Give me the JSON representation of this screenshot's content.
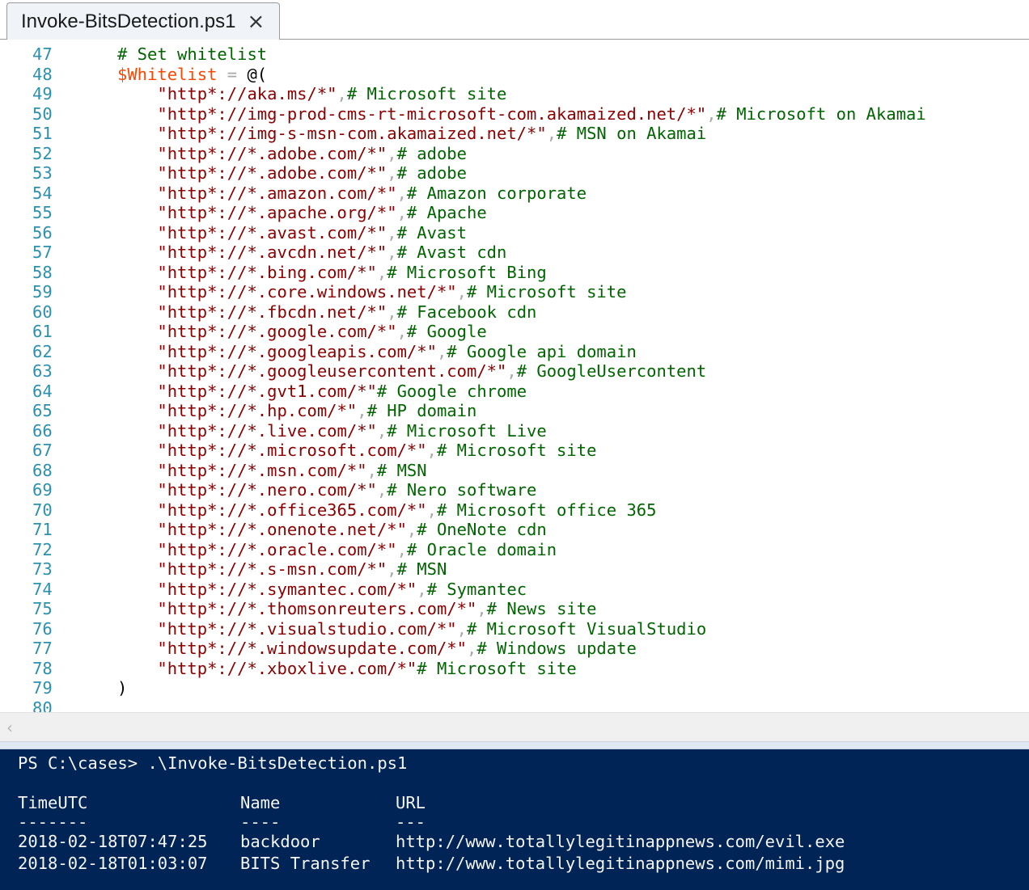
{
  "tab": {
    "title": "Invoke-BitsDetection.ps1",
    "close_icon": "×"
  },
  "editor": {
    "lines": [
      {
        "num": "47",
        "parts": [
          {
            "cls": "cmt",
            "text": "# Set whitelist"
          }
        ]
      },
      {
        "num": "48",
        "parts": [
          {
            "cls": "var",
            "text": "$Whitelist"
          },
          {
            "cls": "op",
            "text": " = "
          },
          {
            "cls": "",
            "text": "@("
          }
        ]
      },
      {
        "num": "49",
        "parts": [
          {
            "cls": "str",
            "text": "    \"http*://aka.ms/*\""
          },
          {
            "cls": "op",
            "text": ","
          },
          {
            "cls": "cmt",
            "text": "# Microsoft site"
          }
        ]
      },
      {
        "num": "50",
        "parts": [
          {
            "cls": "str",
            "text": "    \"http*://img-prod-cms-rt-microsoft-com.akamaized.net/*\""
          },
          {
            "cls": "op",
            "text": ","
          },
          {
            "cls": "cmt",
            "text": "# Microsoft on Akamai"
          }
        ]
      },
      {
        "num": "51",
        "parts": [
          {
            "cls": "str",
            "text": "    \"http*://img-s-msn-com.akamaized.net/*\""
          },
          {
            "cls": "op",
            "text": ","
          },
          {
            "cls": "cmt",
            "text": "# MSN on Akamai"
          }
        ]
      },
      {
        "num": "52",
        "parts": [
          {
            "cls": "str",
            "text": "    \"http*://*.adobe.com/*\""
          },
          {
            "cls": "op",
            "text": ","
          },
          {
            "cls": "cmt",
            "text": "# adobe"
          }
        ]
      },
      {
        "num": "53",
        "parts": [
          {
            "cls": "str",
            "text": "    \"http*://*.adobe.com/*\""
          },
          {
            "cls": "op",
            "text": ","
          },
          {
            "cls": "cmt",
            "text": "# adobe"
          }
        ]
      },
      {
        "num": "54",
        "parts": [
          {
            "cls": "str",
            "text": "    \"http*://*.amazon.com/*\""
          },
          {
            "cls": "op",
            "text": ","
          },
          {
            "cls": "cmt",
            "text": "# Amazon corporate"
          }
        ]
      },
      {
        "num": "55",
        "parts": [
          {
            "cls": "str",
            "text": "    \"http*://*.apache.org/*\""
          },
          {
            "cls": "op",
            "text": ","
          },
          {
            "cls": "cmt",
            "text": "# Apache"
          }
        ]
      },
      {
        "num": "56",
        "parts": [
          {
            "cls": "str",
            "text": "    \"http*://*.avast.com/*\""
          },
          {
            "cls": "op",
            "text": ","
          },
          {
            "cls": "cmt",
            "text": "# Avast"
          }
        ]
      },
      {
        "num": "57",
        "parts": [
          {
            "cls": "str",
            "text": "    \"http*://*.avcdn.net/*\""
          },
          {
            "cls": "op",
            "text": ","
          },
          {
            "cls": "cmt",
            "text": "# Avast cdn"
          }
        ]
      },
      {
        "num": "58",
        "parts": [
          {
            "cls": "str",
            "text": "    \"http*://*.bing.com/*\""
          },
          {
            "cls": "op",
            "text": ","
          },
          {
            "cls": "cmt",
            "text": "# Microsoft Bing"
          }
        ]
      },
      {
        "num": "59",
        "parts": [
          {
            "cls": "str",
            "text": "    \"http*://*.core.windows.net/*\""
          },
          {
            "cls": "op",
            "text": ","
          },
          {
            "cls": "cmt",
            "text": "# Microsoft site"
          }
        ]
      },
      {
        "num": "60",
        "parts": [
          {
            "cls": "str",
            "text": "    \"http*://*.fbcdn.net/*\""
          },
          {
            "cls": "op",
            "text": ","
          },
          {
            "cls": "cmt",
            "text": "# Facebook cdn"
          }
        ]
      },
      {
        "num": "61",
        "parts": [
          {
            "cls": "str",
            "text": "    \"http*://*.google.com/*\""
          },
          {
            "cls": "op",
            "text": ","
          },
          {
            "cls": "cmt",
            "text": "# Google"
          }
        ]
      },
      {
        "num": "62",
        "parts": [
          {
            "cls": "str",
            "text": "    \"http*://*.googleapis.com/*\""
          },
          {
            "cls": "op",
            "text": ","
          },
          {
            "cls": "cmt",
            "text": "# Google api domain"
          }
        ]
      },
      {
        "num": "63",
        "parts": [
          {
            "cls": "str",
            "text": "    \"http*://*.googleusercontent.com/*\""
          },
          {
            "cls": "op",
            "text": ","
          },
          {
            "cls": "cmt",
            "text": "# GoogleUsercontent"
          }
        ]
      },
      {
        "num": "64",
        "parts": [
          {
            "cls": "str",
            "text": "    \"http*://*.gvt1.com/*\""
          },
          {
            "cls": "cmt",
            "text": "# Google chrome"
          }
        ]
      },
      {
        "num": "65",
        "parts": [
          {
            "cls": "str",
            "text": "    \"http*://*.hp.com/*\""
          },
          {
            "cls": "op",
            "text": ","
          },
          {
            "cls": "cmt",
            "text": "# HP domain"
          }
        ]
      },
      {
        "num": "66",
        "parts": [
          {
            "cls": "str",
            "text": "    \"http*://*.live.com/*\""
          },
          {
            "cls": "op",
            "text": ","
          },
          {
            "cls": "cmt",
            "text": "# Microsoft Live"
          }
        ]
      },
      {
        "num": "67",
        "parts": [
          {
            "cls": "str",
            "text": "    \"http*://*.microsoft.com/*\""
          },
          {
            "cls": "op",
            "text": ","
          },
          {
            "cls": "cmt",
            "text": "# Microsoft site"
          }
        ]
      },
      {
        "num": "68",
        "parts": [
          {
            "cls": "str",
            "text": "    \"http*://*.msn.com/*\""
          },
          {
            "cls": "op",
            "text": ","
          },
          {
            "cls": "cmt",
            "text": "# MSN"
          }
        ]
      },
      {
        "num": "69",
        "parts": [
          {
            "cls": "str",
            "text": "    \"http*://*.nero.com/*\""
          },
          {
            "cls": "op",
            "text": ","
          },
          {
            "cls": "cmt",
            "text": "# Nero software"
          }
        ]
      },
      {
        "num": "70",
        "parts": [
          {
            "cls": "str",
            "text": "    \"http*://*.office365.com/*\""
          },
          {
            "cls": "op",
            "text": ","
          },
          {
            "cls": "cmt",
            "text": "# Microsoft office 365"
          }
        ]
      },
      {
        "num": "71",
        "parts": [
          {
            "cls": "str",
            "text": "    \"http*://*.onenote.net/*\""
          },
          {
            "cls": "op",
            "text": ","
          },
          {
            "cls": "cmt",
            "text": "# OneNote cdn"
          }
        ]
      },
      {
        "num": "72",
        "parts": [
          {
            "cls": "str",
            "text": "    \"http*://*.oracle.com/*\""
          },
          {
            "cls": "op",
            "text": ","
          },
          {
            "cls": "cmt",
            "text": "# Oracle domain"
          }
        ]
      },
      {
        "num": "73",
        "parts": [
          {
            "cls": "str",
            "text": "    \"http*://*.s-msn.com/*\""
          },
          {
            "cls": "op",
            "text": ","
          },
          {
            "cls": "cmt",
            "text": "# MSN"
          }
        ]
      },
      {
        "num": "74",
        "parts": [
          {
            "cls": "str",
            "text": "    \"http*://*.symantec.com/*\""
          },
          {
            "cls": "op",
            "text": ","
          },
          {
            "cls": "cmt",
            "text": "# Symantec"
          }
        ]
      },
      {
        "num": "75",
        "parts": [
          {
            "cls": "str",
            "text": "    \"http*://*.thomsonreuters.com/*\""
          },
          {
            "cls": "op",
            "text": ","
          },
          {
            "cls": "cmt",
            "text": "# News site"
          }
        ]
      },
      {
        "num": "76",
        "parts": [
          {
            "cls": "str",
            "text": "    \"http*://*.visualstudio.com/*\""
          },
          {
            "cls": "op",
            "text": ","
          },
          {
            "cls": "cmt",
            "text": "# Microsoft VisualStudio"
          }
        ]
      },
      {
        "num": "77",
        "parts": [
          {
            "cls": "str",
            "text": "    \"http*://*.windowsupdate.com/*\""
          },
          {
            "cls": "op",
            "text": ","
          },
          {
            "cls": "cmt",
            "text": "# Windows update"
          }
        ]
      },
      {
        "num": "78",
        "parts": [
          {
            "cls": "str",
            "text": "    \"http*://*.xboxlive.com/*\""
          },
          {
            "cls": "cmt",
            "text": "# Microsoft site"
          }
        ]
      },
      {
        "num": "79",
        "parts": [
          {
            "cls": "",
            "text": ")"
          }
        ]
      },
      {
        "num": "80",
        "parts": []
      }
    ]
  },
  "scrollbar": {
    "left_arrow": "‹"
  },
  "console": {
    "prompt": "PS C:\\cases> .\\Invoke-BitsDetection.ps1",
    "headers": [
      "TimeUTC",
      "Name",
      "URL"
    ],
    "underlines": [
      "-------",
      "----",
      "---"
    ],
    "rows": [
      [
        "2018-02-18T07:47:25",
        "backdoor",
        "http://www.totallylegitinappnews.com/evil.exe"
      ],
      [
        "2018-02-18T01:03:07",
        "BITS Transfer",
        "http://www.totallylegitinappnews.com/mimi.jpg"
      ]
    ]
  },
  "colors": {
    "line_number": "#2b91af",
    "string": "#8b0000",
    "comment": "#006400",
    "variable": "#ff4500",
    "console_bg": "#012456"
  }
}
